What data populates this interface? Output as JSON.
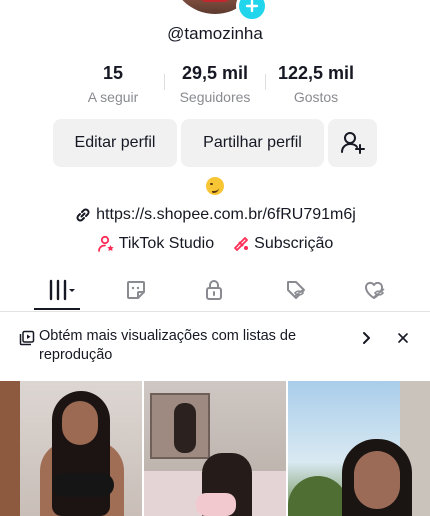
{
  "profile": {
    "username": "@tamozinha",
    "emoji": "😏",
    "link": "https://s.shopee.com.br/6fRU791m6j"
  },
  "stats": [
    {
      "value": "15",
      "label": "A seguir"
    },
    {
      "value": "29,5 mil",
      "label": "Seguidores"
    },
    {
      "value": "122,5 mil",
      "label": "Gostos"
    }
  ],
  "actions": {
    "edit_label": "Editar perfil",
    "share_label": "Partilhar perfil"
  },
  "shortcuts": {
    "studio_label": "TikTok Studio",
    "subscription_label": "Subscrição"
  },
  "banner": {
    "text": "Obtém mais visualizações com listas de reprodução"
  },
  "colors": {
    "accent": "#20d5ec",
    "studio_icon": "#fe2c55",
    "text": "#161823",
    "muted": "#8a8b91",
    "button_bg": "#f1f1f2"
  },
  "icons": {
    "tabs": [
      "videos-grid-icon",
      "sticker-icon",
      "lock-icon",
      "eye-slash-tag-icon",
      "heart-slash-icon"
    ]
  }
}
